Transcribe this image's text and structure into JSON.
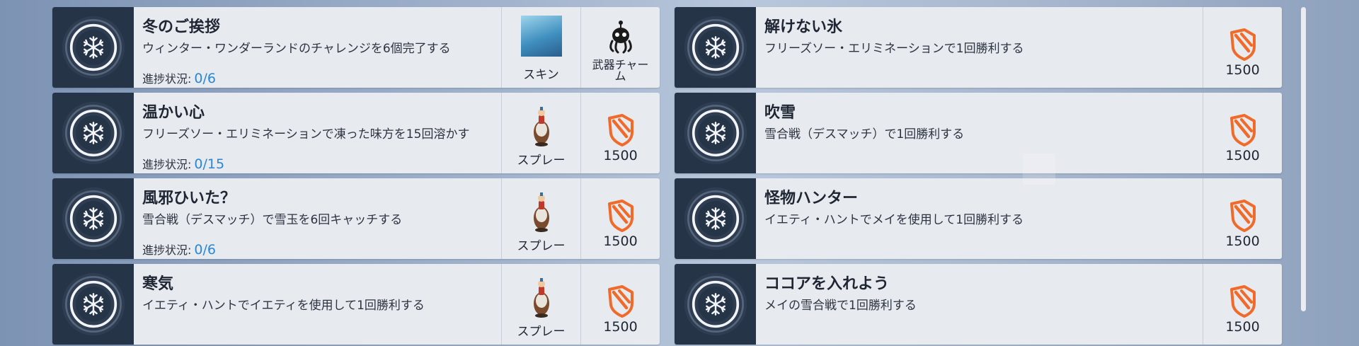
{
  "challenges_left": [
    {
      "title": "冬のご挨拶",
      "desc": "ウィンター・ワンダーランドのチャレンジを6個完了する",
      "progress_label": "進捗状況:",
      "progress_value": "0/6",
      "rewards": [
        {
          "kind": "skin",
          "label": "スキン"
        },
        {
          "kind": "charm",
          "label": "武器チャー\nム"
        }
      ]
    },
    {
      "title": "温かい心",
      "desc": "フリーズソー・エリミネーションで凍った味方を15回溶かす",
      "progress_label": "進捗状況:",
      "progress_value": "0/15",
      "rewards": [
        {
          "kind": "spray",
          "label": "スプレー"
        },
        {
          "kind": "coins",
          "label": "1500"
        }
      ]
    },
    {
      "title": "風邪ひいた？",
      "desc": "雪合戦（デスマッチ）で雪玉を6回キャッチする",
      "progress_label": "進捗状況:",
      "progress_value": "0/6",
      "rewards": [
        {
          "kind": "spray",
          "label": "スプレー"
        },
        {
          "kind": "coins",
          "label": "1500"
        }
      ]
    },
    {
      "title": "寒気",
      "desc": "イエティ・ハントでイエティを使用して1回勝利する",
      "rewards": [
        {
          "kind": "spray",
          "label": "スプレー"
        },
        {
          "kind": "coins",
          "label": "1500"
        }
      ]
    }
  ],
  "challenges_right": [
    {
      "title": "解けない氷",
      "desc": "フリーズソー・エリミネーションで1回勝利する",
      "reward": {
        "kind": "coins",
        "label": "1500"
      }
    },
    {
      "title": "吹雪",
      "desc": "雪合戦（デスマッチ）で1回勝利する",
      "reward": {
        "kind": "coins",
        "label": "1500"
      }
    },
    {
      "title": "怪物ハンター",
      "desc": "イエティ・ハントでメイを使用して1回勝利する",
      "reward": {
        "kind": "coins",
        "label": "1500"
      }
    },
    {
      "title": "ココアを入れよう",
      "desc": "メイの雪合戦で1回勝利する",
      "reward": {
        "kind": "coins",
        "label": "1500"
      }
    }
  ],
  "colors": {
    "icon_panel": "#263447",
    "card": "#e7eaef",
    "progress_value": "#2a86d6",
    "coin": "#f06a2a"
  },
  "icons": {
    "challenge": "snowflake-emblem-icon",
    "coin": "overwatch-coin-icon",
    "charm": "octopus-charm-icon"
  }
}
